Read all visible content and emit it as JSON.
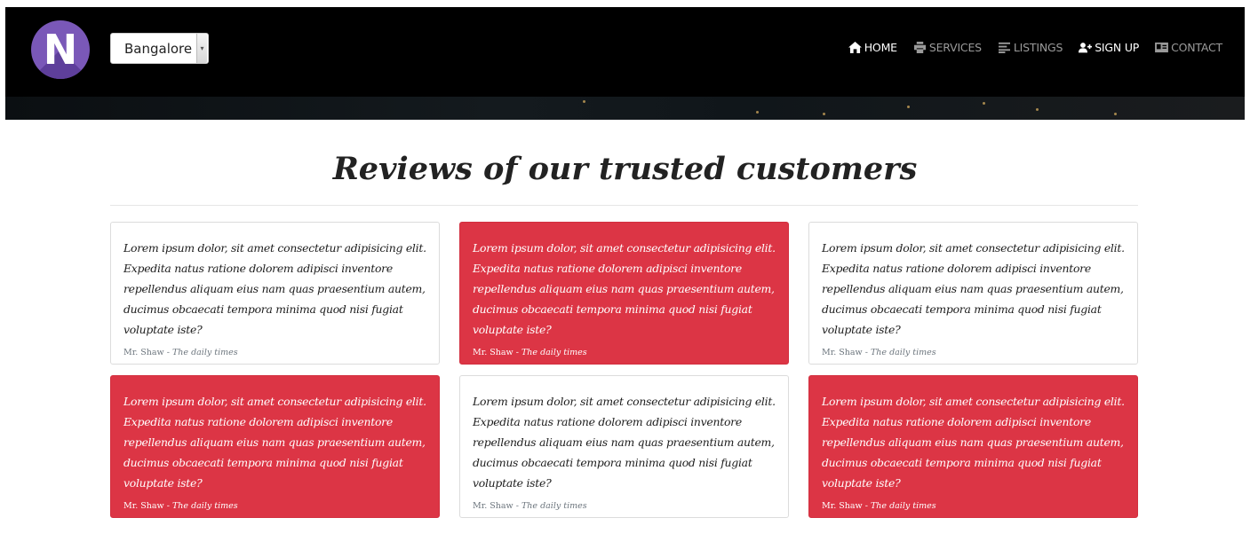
{
  "header": {
    "logo_letter": "N",
    "city": {
      "selected": "Bangalore"
    },
    "nav": [
      {
        "label": "HOME",
        "icon": "home-icon",
        "active": true
      },
      {
        "label": "SERVICES",
        "icon": "print-icon",
        "active": false
      },
      {
        "label": "LISTINGS",
        "icon": "list-icon",
        "active": false
      },
      {
        "label": "SIGN UP",
        "icon": "user-plus-icon",
        "active": false
      },
      {
        "label": "CONTACT",
        "icon": "id-card-icon",
        "active": false
      }
    ]
  },
  "reviews": {
    "title": "Reviews of our trusted customers",
    "cards": [
      {
        "text": "Lorem ipsum dolor, sit amet consectetur adipisicing elit. Expedita natus ratione dolorem adipisci inventore repellendus aliquam eius nam quas praesentium autem, ducimus obcaecati tempora minima quod nisi fugiat voluptate iste?",
        "author": "Mr. Shaw",
        "separator": "-",
        "source": "The daily times",
        "style": "white"
      },
      {
        "text": "Lorem ipsum dolor, sit amet consectetur adipisicing elit. Expedita natus ratione dolorem adipisci inventore repellendus aliquam eius nam quas praesentium autem, ducimus obcaecati tempora minima quod nisi fugiat voluptate iste?",
        "author": "Mr. Shaw",
        "separator": "-",
        "source": "The daily times",
        "style": "red"
      },
      {
        "text": "Lorem ipsum dolor, sit amet consectetur adipisicing elit. Expedita natus ratione dolorem adipisci inventore repellendus aliquam eius nam quas praesentium autem, ducimus obcaecati tempora minima quod nisi fugiat voluptate iste?",
        "author": "Mr. Shaw",
        "separator": "-",
        "source": "The daily times",
        "style": "white"
      },
      {
        "text": "Lorem ipsum dolor, sit amet consectetur adipisicing elit. Expedita natus ratione dolorem adipisci inventore repellendus aliquam eius nam quas praesentium autem, ducimus obcaecati tempora minima quod nisi fugiat voluptate iste?",
        "author": "Mr. Shaw",
        "separator": "-",
        "source": "The daily times",
        "style": "red"
      },
      {
        "text": "Lorem ipsum dolor, sit amet consectetur adipisicing elit. Expedita natus ratione dolorem adipisci inventore repellendus aliquam eius nam quas praesentium autem, ducimus obcaecati tempora minima quod nisi fugiat voluptate iste?",
        "author": "Mr. Shaw",
        "separator": "-",
        "source": "The daily times",
        "style": "white"
      },
      {
        "text": "Lorem ipsum dolor, sit amet consectetur adipisicing elit. Expedita natus ratione dolorem adipisci inventore repellendus aliquam eius nam quas praesentium autem, ducimus obcaecati tempora minima quod nisi fugiat voluptate iste?",
        "author": "Mr. Shaw",
        "separator": "-",
        "source": "The daily times",
        "style": "red"
      }
    ]
  },
  "colors": {
    "accent_red": "#dc3545",
    "navbar_bg": "#000000",
    "logo_purple": "#7a58b8"
  }
}
